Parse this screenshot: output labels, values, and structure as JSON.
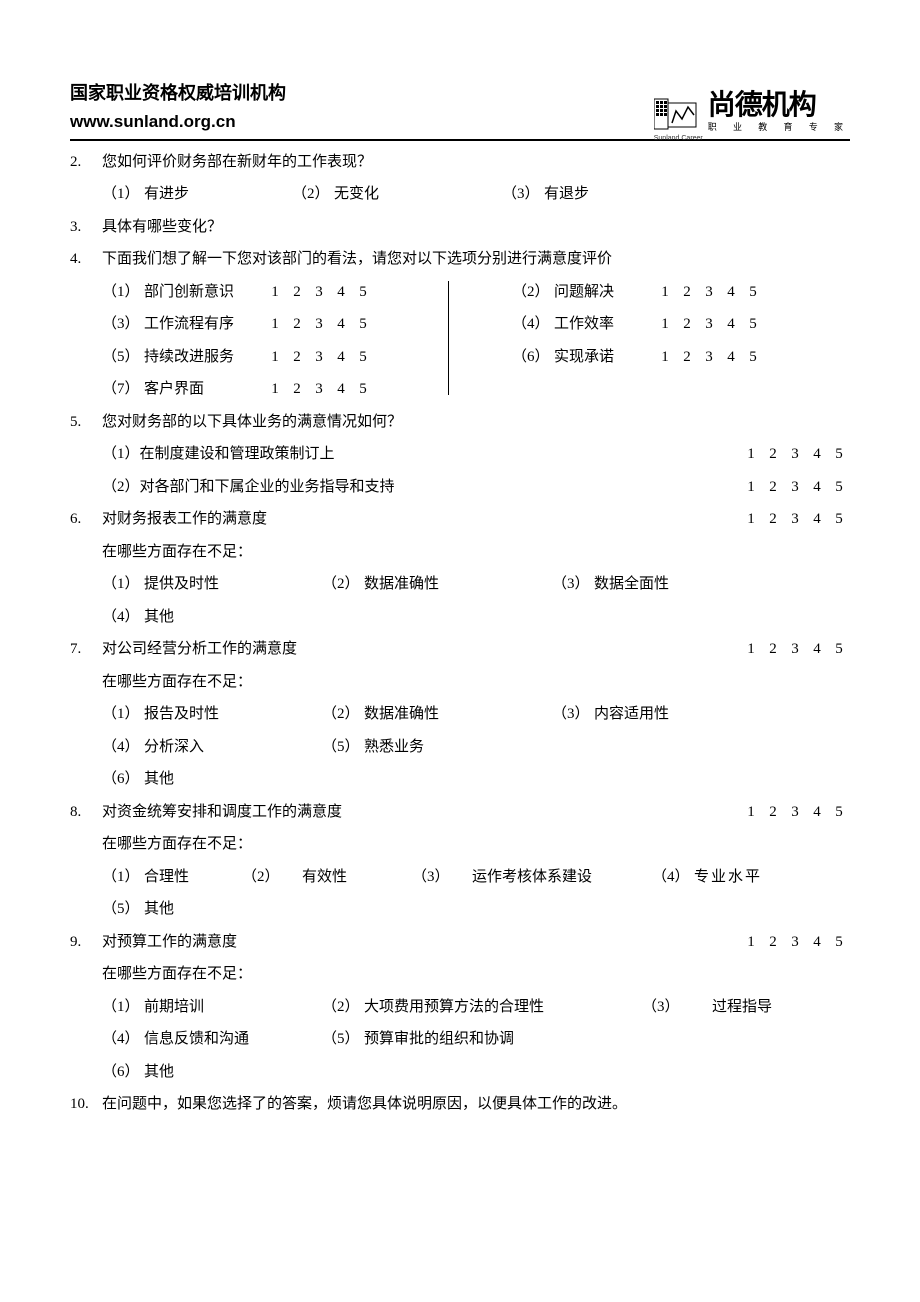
{
  "header": {
    "title_cn": "国家职业资格权威培训机构",
    "url": "www.sunland.org.cn",
    "brand_cn": "尚德机构",
    "brand_sub": "职 业 教 育 专 家",
    "brand_en": "Sunland Career"
  },
  "scale_values": [
    "1",
    "2",
    "3",
    "4",
    "5"
  ],
  "q2": {
    "num": "2.",
    "text": "您如何评价财务部在新财年的工作表现？",
    "options": [
      {
        "pn": "（1）",
        "label": "有进步"
      },
      {
        "pn": "（2）",
        "label": "无变化"
      },
      {
        "pn": "（3）",
        "label": "有退步"
      }
    ]
  },
  "q3": {
    "num": "3.",
    "text": "具体有哪些变化？"
  },
  "q4": {
    "num": "4.",
    "text": "下面我们想了解一下您对该部门的看法，请您对以下选项分别进行满意度评价",
    "items": [
      {
        "pn": "（1）",
        "label": "部门创新意识"
      },
      {
        "pn": "（2）",
        "label": "问题解决"
      },
      {
        "pn": "（3）",
        "label": "工作流程有序"
      },
      {
        "pn": "（4）",
        "label": "工作效率"
      },
      {
        "pn": "（5）",
        "label": "持续改进服务"
      },
      {
        "pn": "（6）",
        "label": "实现承诺"
      },
      {
        "pn": "（7）",
        "label": "客户界面"
      }
    ]
  },
  "q5": {
    "num": "5.",
    "text": "您对财务部的以下具体业务的满意情况如何？",
    "items": [
      {
        "pn": "（1）",
        "label": "在制度建设和管理政策制订上"
      },
      {
        "pn": "（2）",
        "label": "对各部门和下属企业的业务指导和支持"
      }
    ]
  },
  "q6": {
    "num": "6.",
    "text": "对财务报表工作的满意度",
    "sub_prompt": "在哪些方面存在不足：",
    "options": [
      {
        "pn": "（1）",
        "label": "提供及时性"
      },
      {
        "pn": "（2）",
        "label": "数据准确性"
      },
      {
        "pn": "（3）",
        "label": "数据全面性"
      },
      {
        "pn": "（4）",
        "label": "其他"
      }
    ]
  },
  "q7": {
    "num": "7.",
    "text": "对公司经营分析工作的满意度",
    "sub_prompt": "在哪些方面存在不足：",
    "options": [
      {
        "pn": "（1）",
        "label": "报告及时性"
      },
      {
        "pn": "（2）",
        "label": "数据准确性"
      },
      {
        "pn": "（3）",
        "label": "内容适用性"
      },
      {
        "pn": "（4）",
        "label": "分析深入"
      },
      {
        "pn": "（5）",
        "label": "熟悉业务"
      },
      {
        "pn": "（6）",
        "label": "其他"
      }
    ]
  },
  "q8": {
    "num": "8.",
    "text": "对资金统筹安排和调度工作的满意度",
    "sub_prompt": "在哪些方面存在不足：",
    "options": [
      {
        "pn": "（1）",
        "label": "合理性"
      },
      {
        "pn": "（2）",
        "label": "有效性"
      },
      {
        "pn": "（3）",
        "label": "运作考核体系建设"
      },
      {
        "pn": "（4）",
        "label": "专业水平"
      },
      {
        "pn": "（5）",
        "label": "其他"
      }
    ]
  },
  "q9": {
    "num": "9.",
    "text": "对预算工作的满意度",
    "sub_prompt": "在哪些方面存在不足：",
    "options": [
      {
        "pn": "（1）",
        "label": "前期培训"
      },
      {
        "pn": "（2）",
        "label": "大项费用预算方法的合理性"
      },
      {
        "pn": "（3）",
        "label": "过程指导"
      },
      {
        "pn": "（4）",
        "label": "信息反馈和沟通"
      },
      {
        "pn": "（5）",
        "label": "预算审批的组织和协调"
      },
      {
        "pn": "（6）",
        "label": "其他"
      }
    ]
  },
  "q10": {
    "num": "10.",
    "text": "在问题中，如果您选择了的答案，烦请您具体说明原因，以便具体工作的改进。"
  }
}
